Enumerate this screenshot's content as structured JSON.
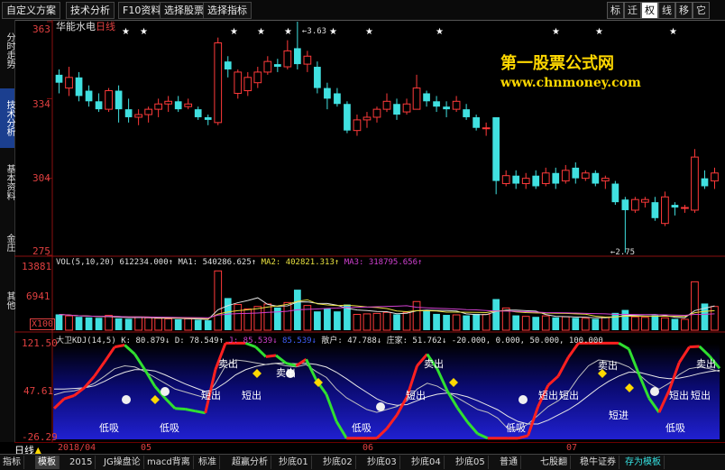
{
  "toolbar": {
    "buttons": [
      "自定义方案",
      "技术分析",
      "F10资料",
      "选择股票",
      "选择指标"
    ],
    "right_buttons": [
      "标",
      "迁",
      "权",
      "线",
      "移",
      "它"
    ],
    "active_right": "权"
  },
  "left_tabs": [
    "分时走势",
    "技术分析",
    "基本资料",
    "金庄",
    "其他"
  ],
  "active_left_tab": "技术分析",
  "stock": {
    "name": "华能水电",
    "period": "日线"
  },
  "price_axis": {
    "labels": [
      "363",
      "334",
      "304",
      "275"
    ],
    "ylim": [
      275,
      363
    ]
  },
  "annotations": {
    "high": "3.63",
    "low": "2.75"
  },
  "watermark": {
    "title": "第一股票公式网",
    "url": "www.chnmoney.com"
  },
  "volume": {
    "header": "VOL(5,10,20)",
    "value": "612234.000↑",
    "ma1": "MA1: 540286.625↑",
    "ma2": "MA2: 402821.313↑",
    "ma3": "MA3: 318795.656↑",
    "axis": [
      "13881",
      "6941"
    ],
    "unit": "X100"
  },
  "kdj": {
    "header": "大卫KDJ(14,5)",
    "k": "K: 80.879↓",
    "d": "D: 78.549↑",
    "j": "J: 85.539↓",
    "extra": "85.539↓",
    "sanhu": "散户: 47.788↓",
    "zhuangjia": "庄家: 51.762↓",
    "levels": "-20.000, 0.000, 50.000, 100.000",
    "axis": [
      "121.50",
      "47.61",
      "-26.29"
    ],
    "labels_sell": [
      "卖出",
      "卖出",
      "卖出",
      "卖出",
      "卖出"
    ],
    "labels_short": [
      "短出",
      "短出",
      "短出",
      "短出",
      "短出",
      "短出",
      "短出"
    ],
    "labels_low": [
      "低吸",
      "低吸",
      "低吸",
      "低吸",
      "低吸"
    ],
    "label_shorttrade": "短进"
  },
  "date_axis": {
    "period_label": "日线",
    "dates": [
      "2018/04",
      "05",
      "06",
      "07"
    ]
  },
  "bottom_tabs": [
    "指标",
    "模板",
    "2015",
    "JG操盘论",
    "macd背离",
    "标准",
    "超赢分析",
    "抄底01",
    "抄底02",
    "抄底03",
    "抄底04",
    "抄底05",
    "普通",
    "七股翻",
    "稳牛证券",
    "存为模板"
  ],
  "active_bottom_tab": "模板",
  "chart_data": [
    {
      "type": "candlestick",
      "title": "华能水电 日线",
      "ylim": [
        275,
        363
      ],
      "candles": [
        {
          "o": 340,
          "c": 343,
          "h": 345,
          "l": 336,
          "up": false
        },
        {
          "o": 342,
          "c": 338,
          "h": 346,
          "l": 335,
          "up": true
        },
        {
          "o": 342,
          "c": 335,
          "h": 344,
          "l": 333,
          "up": false
        },
        {
          "o": 337,
          "c": 333,
          "h": 339,
          "l": 331,
          "up": false
        },
        {
          "o": 333,
          "c": 330,
          "h": 336,
          "l": 329,
          "up": false
        },
        {
          "o": 330,
          "c": 337,
          "h": 338,
          "l": 329,
          "up": true
        },
        {
          "o": 337,
          "c": 330,
          "h": 339,
          "l": 325,
          "up": false
        },
        {
          "o": 330,
          "c": 327,
          "h": 334,
          "l": 325,
          "up": false
        },
        {
          "o": 327,
          "c": 328,
          "h": 330,
          "l": 324,
          "up": true
        },
        {
          "o": 328,
          "c": 330,
          "h": 331,
          "l": 325,
          "up": true
        },
        {
          "o": 330,
          "c": 332,
          "h": 334,
          "l": 327,
          "up": true
        },
        {
          "o": 332,
          "c": 333,
          "h": 335,
          "l": 329,
          "up": true
        },
        {
          "o": 333,
          "c": 330,
          "h": 335,
          "l": 329,
          "up": false
        },
        {
          "o": 331,
          "c": 332,
          "h": 334,
          "l": 330,
          "up": true
        },
        {
          "o": 330,
          "c": 327,
          "h": 331,
          "l": 326,
          "up": false
        },
        {
          "o": 327,
          "c": 326,
          "h": 328,
          "l": 324,
          "up": false
        },
        {
          "o": 325,
          "c": 355,
          "h": 357,
          "l": 324,
          "up": true
        },
        {
          "o": 345,
          "c": 348,
          "h": 350,
          "l": 342,
          "up": false
        },
        {
          "o": 344,
          "c": 336,
          "h": 345,
          "l": 334,
          "up": true
        },
        {
          "o": 337,
          "c": 342,
          "h": 344,
          "l": 335,
          "up": true
        },
        {
          "o": 340,
          "c": 344,
          "h": 346,
          "l": 338,
          "up": true
        },
        {
          "o": 344,
          "c": 348,
          "h": 350,
          "l": 343,
          "up": true
        },
        {
          "o": 346,
          "c": 347,
          "h": 349,
          "l": 344,
          "up": false
        },
        {
          "o": 346,
          "c": 352,
          "h": 356,
          "l": 345,
          "up": true
        },
        {
          "o": 353,
          "c": 347,
          "h": 363,
          "l": 345,
          "up": false
        },
        {
          "o": 347,
          "c": 350,
          "h": 352,
          "l": 344,
          "up": true
        },
        {
          "o": 346,
          "c": 338,
          "h": 348,
          "l": 336,
          "up": false
        },
        {
          "o": 338,
          "c": 334,
          "h": 340,
          "l": 330,
          "up": false
        },
        {
          "o": 336,
          "c": 332,
          "h": 338,
          "l": 331,
          "up": false
        },
        {
          "o": 332,
          "c": 322,
          "h": 333,
          "l": 321,
          "up": false
        },
        {
          "o": 322,
          "c": 326,
          "h": 328,
          "l": 320,
          "up": true
        },
        {
          "o": 326,
          "c": 327,
          "h": 329,
          "l": 323,
          "up": true
        },
        {
          "o": 327,
          "c": 330,
          "h": 331,
          "l": 325,
          "up": true
        },
        {
          "o": 330,
          "c": 333,
          "h": 336,
          "l": 329,
          "up": true
        },
        {
          "o": 332,
          "c": 328,
          "h": 334,
          "l": 326,
          "up": false
        },
        {
          "o": 329,
          "c": 332,
          "h": 334,
          "l": 328,
          "up": true
        },
        {
          "o": 330,
          "c": 338,
          "h": 343,
          "l": 330,
          "up": true
        },
        {
          "o": 336,
          "c": 333,
          "h": 337,
          "l": 331,
          "up": false
        },
        {
          "o": 333,
          "c": 331,
          "h": 335,
          "l": 329,
          "up": false
        },
        {
          "o": 331,
          "c": 330,
          "h": 333,
          "l": 327,
          "up": false
        },
        {
          "o": 330,
          "c": 333,
          "h": 335,
          "l": 329,
          "up": true
        },
        {
          "o": 330,
          "c": 327,
          "h": 332,
          "l": 326,
          "up": false
        },
        {
          "o": 327,
          "c": 323,
          "h": 328,
          "l": 322,
          "up": false
        },
        {
          "o": 323,
          "c": 323,
          "h": 325,
          "l": 320,
          "up": true
        },
        {
          "o": 327,
          "c": 303,
          "h": 327,
          "l": 298,
          "up": false
        },
        {
          "o": 302,
          "c": 305,
          "h": 307,
          "l": 301,
          "up": true
        },
        {
          "o": 305,
          "c": 302,
          "h": 307,
          "l": 300,
          "up": false
        },
        {
          "o": 302,
          "c": 304,
          "h": 306,
          "l": 300,
          "up": true
        },
        {
          "o": 305,
          "c": 301,
          "h": 307,
          "l": 300,
          "up": false
        },
        {
          "o": 302,
          "c": 306,
          "h": 308,
          "l": 301,
          "up": true
        },
        {
          "o": 306,
          "c": 302,
          "h": 308,
          "l": 300,
          "up": false
        },
        {
          "o": 303,
          "c": 307,
          "h": 309,
          "l": 302,
          "up": true
        },
        {
          "o": 308,
          "c": 304,
          "h": 310,
          "l": 302,
          "up": false
        },
        {
          "o": 304,
          "c": 306,
          "h": 307,
          "l": 303,
          "up": true
        },
        {
          "o": 306,
          "c": 302,
          "h": 307,
          "l": 301,
          "up": false
        },
        {
          "o": 303,
          "c": 304,
          "h": 305,
          "l": 300,
          "up": true
        },
        {
          "o": 302,
          "c": 295,
          "h": 303,
          "l": 294,
          "up": false
        },
        {
          "o": 296,
          "c": 292,
          "h": 297,
          "l": 276,
          "up": false
        },
        {
          "o": 292,
          "c": 296,
          "h": 297,
          "l": 291,
          "up": true
        },
        {
          "o": 295,
          "c": 296,
          "h": 297,
          "l": 293,
          "up": true
        },
        {
          "o": 295,
          "c": 289,
          "h": 297,
          "l": 288,
          "up": false
        },
        {
          "o": 287,
          "c": 297,
          "h": 299,
          "l": 286,
          "up": true
        },
        {
          "o": 294,
          "c": 293,
          "h": 295,
          "l": 290,
          "up": false
        },
        {
          "o": 293,
          "c": 293,
          "h": 294,
          "l": 291,
          "up": true
        },
        {
          "o": 292,
          "c": 312,
          "h": 315,
          "l": 291,
          "up": true
        },
        {
          "o": 301,
          "c": 304,
          "h": 307,
          "l": 300,
          "up": false
        },
        {
          "o": 303,
          "c": 306,
          "h": 308,
          "l": 300,
          "up": true
        }
      ]
    },
    {
      "type": "bar",
      "title": "VOL(5,10,20)",
      "ylim": [
        0,
        13881
      ],
      "values": [
        3200,
        2900,
        2700,
        2600,
        2500,
        3000,
        2400,
        2300,
        2600,
        2500,
        2400,
        2300,
        2200,
        2300,
        2100,
        2000,
        12000,
        6500,
        5200,
        4300,
        4800,
        5300,
        4600,
        5600,
        8200,
        5000,
        3800,
        4400,
        3800,
        5200,
        3200,
        3300,
        3400,
        3600,
        3200,
        3600,
        5800,
        4100,
        3300,
        3100,
        3100,
        3000,
        3300,
        3200,
        6300,
        4500,
        3000,
        2800,
        2700,
        2900,
        2600,
        2700,
        2500,
        2400,
        2300,
        2600,
        3500,
        4100,
        2700,
        2600,
        3000,
        2500,
        2300,
        2200,
        9800,
        5400,
        4800
      ]
    },
    {
      "type": "line",
      "title": "大卫KDJ(14,5)",
      "ylim": [
        -26.29,
        121.5
      ],
      "x_count": 67,
      "series": [
        {
          "name": "K",
          "values": [
            40,
            45,
            47,
            52,
            60,
            72,
            85,
            90,
            88,
            80,
            70,
            60,
            50,
            45,
            40,
            35,
            60,
            90,
            100,
            98,
            95,
            92,
            94,
            90,
            88,
            92,
            80,
            70,
            50,
            35,
            25,
            15,
            10,
            15,
            20,
            30,
            50,
            60,
            55,
            45,
            35,
            25,
            15,
            10,
            0,
            -18,
            -20,
            -10,
            5,
            20,
            30,
            45,
            70,
            90,
            100,
            98,
            95,
            88,
            75,
            60,
            50,
            60,
            75,
            85,
            88,
            85,
            80
          ]
        },
        {
          "name": "D",
          "values": [
            50,
            50,
            51,
            52,
            55,
            62,
            70,
            76,
            80,
            80,
            78,
            72,
            65,
            58,
            52,
            46,
            50,
            60,
            72,
            80,
            85,
            88,
            90,
            90,
            89,
            90,
            88,
            84,
            76,
            66,
            55,
            45,
            35,
            28,
            25,
            26,
            32,
            38,
            42,
            44,
            42,
            38,
            32,
            25,
            18,
            8,
            0,
            -4,
            -4,
            2,
            10,
            18,
            28,
            40,
            52,
            62,
            70,
            76,
            76,
            72,
            68,
            66,
            67,
            70,
            74,
            77,
            79
          ]
        },
        {
          "name": "J",
          "values": [
            20,
            35,
            40,
            52,
            70,
            92,
            115,
            118,
            104,
            80,
            54,
            36,
            20,
            19,
            16,
            13,
            80,
            121,
            121,
            121,
            115,
            100,
            102,
            90,
            86,
            96,
            64,
            42,
            0,
            -26,
            -26,
            -26,
            -26,
            -11,
            10,
            38,
            86,
            104,
            81,
            47,
            21,
            -1,
            -19,
            -26,
            -26,
            -26,
            -26,
            -22,
            23,
            56,
            70,
            99,
            121,
            121,
            121,
            121,
            121,
            112,
            73,
            36,
            14,
            48,
            91,
            115,
            116,
            101,
            82
          ]
        }
      ]
    }
  ]
}
